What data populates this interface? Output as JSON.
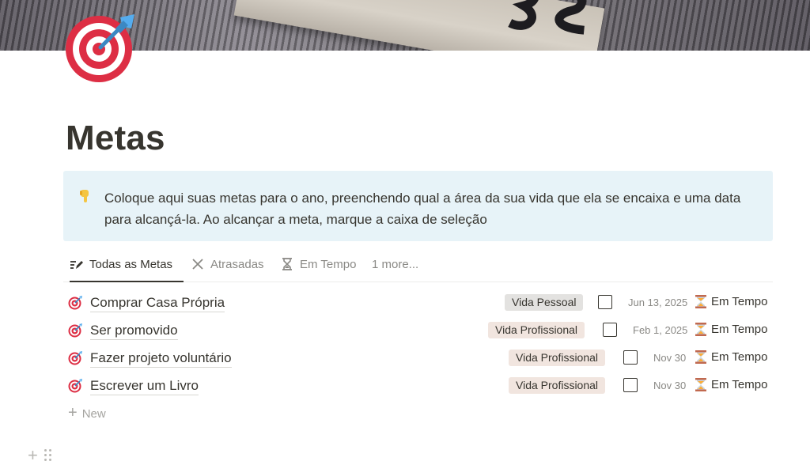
{
  "page": {
    "title": "Metas",
    "icon": "target-icon"
  },
  "callout": {
    "icon": "pointing-down-icon",
    "text": "Coloque aqui suas metas para o ano, preenchendo qual a área da sua vida que ela se encaixa e uma data para alcançá-la. Ao alcançar a meta, marque a caixa de seleção"
  },
  "tabs": [
    {
      "label": "Todas as Metas",
      "icon": "edit-list-icon",
      "active": true
    },
    {
      "label": "Atrasadas",
      "icon": "x-icon",
      "active": false
    },
    {
      "label": "Em Tempo",
      "icon": "hourglass-icon",
      "active": false
    },
    {
      "label": "1 more...",
      "active": false
    }
  ],
  "rows": [
    {
      "title": "Comprar Casa Própria",
      "area": "Vida Pessoal",
      "done": false,
      "date": "Jun 13, 2025",
      "status": "Em Tempo"
    },
    {
      "title": "Ser promovido",
      "area": "Vida Profissional",
      "done": false,
      "date": "Feb 1, 2025",
      "status": "Em Tempo"
    },
    {
      "title": "Fazer projeto voluntário",
      "area": "Vida Profissional",
      "done": false,
      "date": "Nov 30",
      "status": "Em Tempo"
    },
    {
      "title": "Escrever um Livro",
      "area": "Vida Profissional",
      "done": false,
      "date": "Nov 30",
      "status": "Em Tempo"
    }
  ],
  "new_label": "New",
  "colors": {
    "callout_bg": "#e7f3f8",
    "tag_pessoal": "#e3e2e0",
    "tag_profissional": "#f1e5df",
    "text": "#37352f",
    "muted": "#8a8985"
  }
}
